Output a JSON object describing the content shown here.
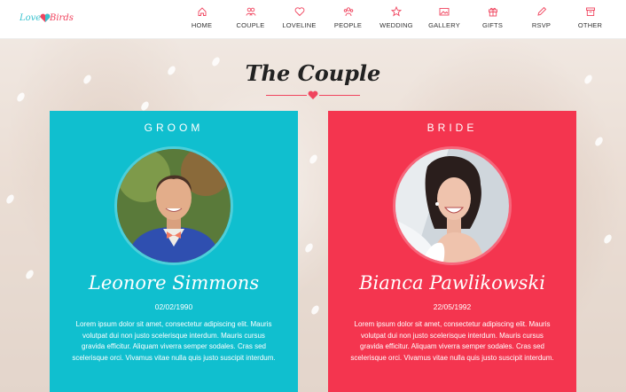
{
  "logo": {
    "part1": "Love",
    "part2": "Birds"
  },
  "nav": {
    "items": [
      {
        "label": "HOME",
        "icon": "home-icon"
      },
      {
        "label": "COUPLE",
        "icon": "couple-icon"
      },
      {
        "label": "LOVELINE",
        "icon": "heart-icon"
      },
      {
        "label": "PEOPLE",
        "icon": "people-icon"
      },
      {
        "label": "WEDDING",
        "icon": "star-icon"
      },
      {
        "label": "GALLERY",
        "icon": "gallery-icon"
      },
      {
        "label": "GIFTS",
        "icon": "gift-icon"
      },
      {
        "label": "RSVP",
        "icon": "pencil-icon"
      },
      {
        "label": "OTHER",
        "icon": "box-icon"
      }
    ]
  },
  "section": {
    "title": "The Couple"
  },
  "groom": {
    "role": "GROOM",
    "name": "Leonore Simmons",
    "date": "02/02/1990",
    "description": "Lorem ipsum dolor sit amet, consectetur adipiscing elit. Mauris volutpat dui non justo scelerisque interdum. Mauris cursus gravida efficitur. Aliquam viverra semper sodales. Cras sed scelerisque orci. Vivamus vitae nulla quis justo suscipit interdum."
  },
  "bride": {
    "role": "BRIDE",
    "name": "Bianca Pawlikowski",
    "date": "22/05/1992",
    "description": "Lorem ipsum dolor sit amet, consectetur adipiscing elit. Mauris volutpat dui non justo scelerisque interdum. Mauris cursus gravida efficitur. Aliquam viverra semper sodales. Cras sed scelerisque orci. Vivamus vitae nulla quis justo suscipit interdum."
  },
  "colors": {
    "accent": "#f0445e",
    "groom_card": "#10bfcf",
    "bride_card": "#f4354f"
  }
}
